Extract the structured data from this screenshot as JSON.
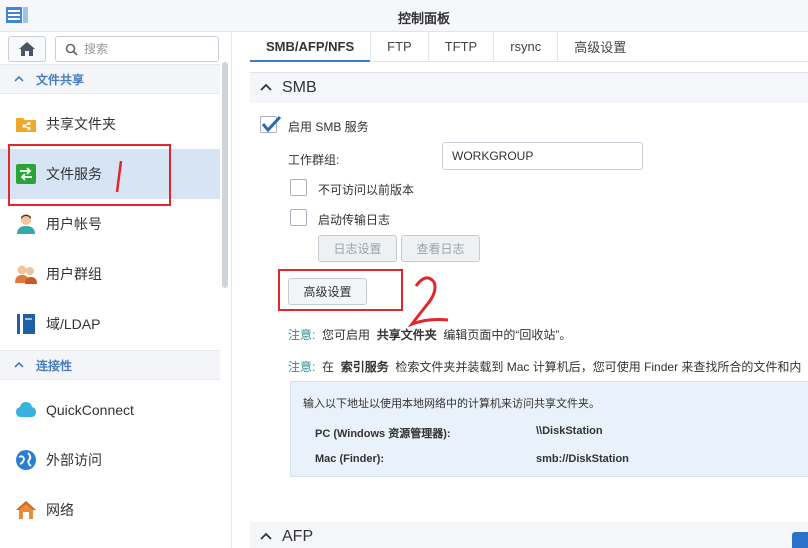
{
  "window": {
    "title": "控制面板"
  },
  "search": {
    "placeholder": "搜索"
  },
  "sidebar": {
    "sections": [
      {
        "label": "文件共享"
      },
      {
        "label": "连接性"
      }
    ],
    "items": [
      {
        "label": "共享文件夹",
        "icon": "share-folder-icon"
      },
      {
        "label": "文件服务",
        "icon": "file-services-icon",
        "active": true
      },
      {
        "label": "用户帐号",
        "icon": "user-icon"
      },
      {
        "label": "用户群组",
        "icon": "user-group-icon"
      },
      {
        "label": "域/LDAP",
        "icon": "domain-ldap-icon"
      },
      {
        "label": "QuickConnect",
        "icon": "quickconnect-icon"
      },
      {
        "label": "外部访问",
        "icon": "external-access-icon"
      },
      {
        "label": "网络",
        "icon": "network-icon"
      }
    ]
  },
  "tabs": [
    {
      "label": "SMB/AFP/NFS",
      "active": true
    },
    {
      "label": "FTP"
    },
    {
      "label": "TFTP"
    },
    {
      "label": "rsync"
    },
    {
      "label": "高级设置"
    }
  ],
  "smb": {
    "header": "SMB",
    "enable_label": "启用 SMB 服务",
    "enable_checked": true,
    "workgroup_label": "工作群组:",
    "workgroup_value": "WORKGROUP",
    "no_prev_versions_label": "不可访问以前版本",
    "transfer_log_label": "启动传输日志",
    "log_settings_btn": "日志设置",
    "view_log_btn": "查看日志",
    "advanced_btn": "高级设置",
    "note1": {
      "key": "注意:",
      "pre": "您可启用",
      "bold": "共享文件夹",
      "post": "编辑页面中的“回收站”。"
    },
    "note2": {
      "key": "注意:",
      "pre": "在",
      "bold": "索引服务",
      "post": "检索文件夹并装载到 Mac 计算机后，您可使用 Finder 来查找所合的文件和内"
    },
    "info": {
      "intro": "输入以下地址以使用本地网络中的计算机来访问共享文件夹。",
      "pc_label": "PC (Windows 资源管理器):",
      "pc_value": "\\\\DiskStation",
      "mac_label": "Mac (Finder):",
      "mac_value": "smb://DiskStation"
    }
  },
  "afp": {
    "header": "AFP"
  },
  "annotations": {
    "mark1": "1",
    "mark2": "2",
    "color": "#e3262c"
  },
  "colors": {
    "accent": "#3a7fcb",
    "active_bg": "#d6e4f3",
    "note": "#2f8f96"
  }
}
